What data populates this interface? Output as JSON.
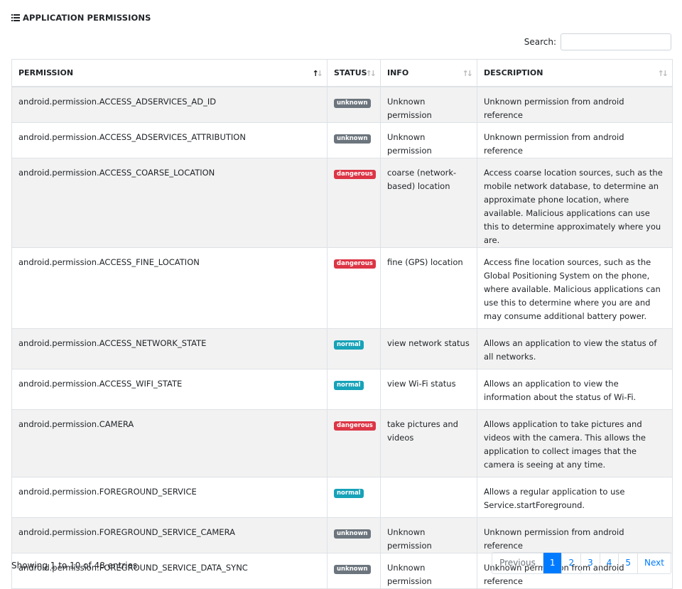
{
  "header": {
    "title": "APPLICATION PERMISSIONS",
    "icon": "list-icon"
  },
  "search": {
    "label": "Search:",
    "value": "",
    "placeholder": ""
  },
  "table": {
    "columns": [
      "PERMISSION",
      "STATUS",
      "INFO",
      "DESCRIPTION"
    ],
    "rows": [
      {
        "permission": "android.permission.ACCESS_ADSERVICES_AD_ID",
        "status": "unknown",
        "info": "Unknown permission",
        "description": "Unknown permission from android reference"
      },
      {
        "permission": "android.permission.ACCESS_ADSERVICES_ATTRIBUTION",
        "status": "unknown",
        "info": "Unknown permission",
        "description": "Unknown permission from android reference"
      },
      {
        "permission": "android.permission.ACCESS_COARSE_LOCATION",
        "status": "dangerous",
        "info": "coarse (network-based) location",
        "description": "Access coarse location sources, such as the mobile network database, to determine an approximate phone location, where available. Malicious applications can use this to determine approximately where you are."
      },
      {
        "permission": "android.permission.ACCESS_FINE_LOCATION",
        "status": "dangerous",
        "info": "fine (GPS) location",
        "description": "Access fine location sources, such as the Global Positioning System on the phone, where available. Malicious applications can use this to determine where you are and may consume additional battery power."
      },
      {
        "permission": "android.permission.ACCESS_NETWORK_STATE",
        "status": "normal",
        "info": "view network status",
        "description": "Allows an application to view the status of all networks."
      },
      {
        "permission": "android.permission.ACCESS_WIFI_STATE",
        "status": "normal",
        "info": "view Wi-Fi status",
        "description": "Allows an application to view the information about the status of Wi-Fi."
      },
      {
        "permission": "android.permission.CAMERA",
        "status": "dangerous",
        "info": "take pictures and videos",
        "description": "Allows application to take pictures and videos with the camera. This allows the application to collect images that the camera is seeing at any time."
      },
      {
        "permission": "android.permission.FOREGROUND_SERVICE",
        "status": "normal",
        "info": "",
        "description": "Allows a regular application to use Service.startForeground."
      },
      {
        "permission": "android.permission.FOREGROUND_SERVICE_CAMERA",
        "status": "unknown",
        "info": "Unknown permission",
        "description": "Unknown permission from android reference"
      },
      {
        "permission": "android.permission.FOREGROUND_SERVICE_DATA_SYNC",
        "status": "unknown",
        "info": "Unknown permission",
        "description": "Unknown permission from android reference"
      }
    ]
  },
  "status_colors": {
    "unknown": "#6c757d",
    "dangerous": "#dc3545",
    "normal": "#17a2b8"
  },
  "footer": {
    "info": "Showing 1 to 10 of 48 entries"
  },
  "pagination": {
    "previous": "Previous",
    "pages": [
      "1",
      "2",
      "3",
      "4",
      "5"
    ],
    "next": "Next",
    "active": "1"
  }
}
